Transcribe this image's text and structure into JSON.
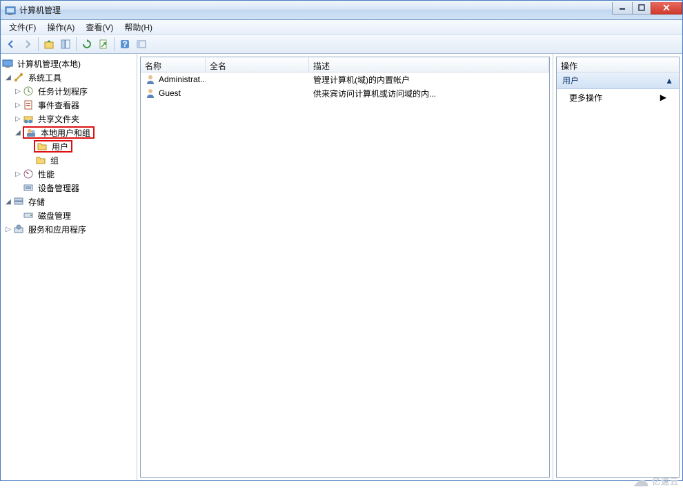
{
  "window": {
    "title": "计算机管理"
  },
  "menu": {
    "file": "文件(F)",
    "action": "操作(A)",
    "view": "查看(V)",
    "help": "帮助(H)"
  },
  "tree": {
    "root": "计算机管理(本地)",
    "systemTools": "系统工具",
    "taskScheduler": "任务计划程序",
    "eventViewer": "事件查看器",
    "sharedFolders": "共享文件夹",
    "localUsersGroups": "本地用户和组",
    "users": "用户",
    "groups": "组",
    "performance": "性能",
    "deviceManager": "设备管理器",
    "storage": "存储",
    "diskManagement": "磁盘管理",
    "servicesApps": "服务和应用程序"
  },
  "list": {
    "headers": {
      "name": "名称",
      "fullName": "全名",
      "description": "描述"
    },
    "rows": [
      {
        "name": "Administrat...",
        "fullName": "",
        "description": "管理计算机(域)的内置帐户"
      },
      {
        "name": "Guest",
        "fullName": "",
        "description": "供来宾访问计算机或访问域的内..."
      }
    ]
  },
  "actions": {
    "title": "操作",
    "section": "用户",
    "more": "更多操作"
  },
  "watermark": "亿速云"
}
